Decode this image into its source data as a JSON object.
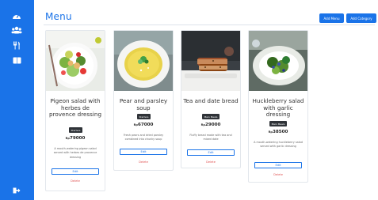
{
  "sidebar": {
    "icons": [
      "dashboard-icon",
      "group-icon",
      "restaurant-icon",
      "menu-book-icon",
      "logout-icon"
    ]
  },
  "header": {
    "title": "Menu",
    "add_menu_label": "Add Menu",
    "add_category_label": "Add Category"
  },
  "cards": [
    {
      "name": "Pigeon salad with herbes de provence dressing",
      "category": "Starters",
      "price": "79000",
      "currency": "Rp",
      "description": "A mouth-watering pigeon salad served with herbes de provence dressing",
      "edit_label": "Edit",
      "delete_label": "Delete"
    },
    {
      "name": "Pear and parsley soup",
      "category": "Starters",
      "price": "67000",
      "currency": "Rp",
      "description": "Fresh pears and dried parsley combined into chunky soup",
      "edit_label": "Edit",
      "delete_label": "Delete"
    },
    {
      "name": "Tea and date bread",
      "category": "Main Meals",
      "price": "29000",
      "currency": "Rp",
      "description": "Fluffy bread made with tea and mixed date",
      "edit_label": "Edit",
      "delete_label": "Delete"
    },
    {
      "name": "Huckleberry salad with garlic dressing",
      "category": "Main Meals",
      "price": "38500",
      "currency": "Rp",
      "description": "A mouth-watering huckleberry salad served with garlic dressing",
      "edit_label": "Edit",
      "delete_label": "Delete"
    }
  ]
}
